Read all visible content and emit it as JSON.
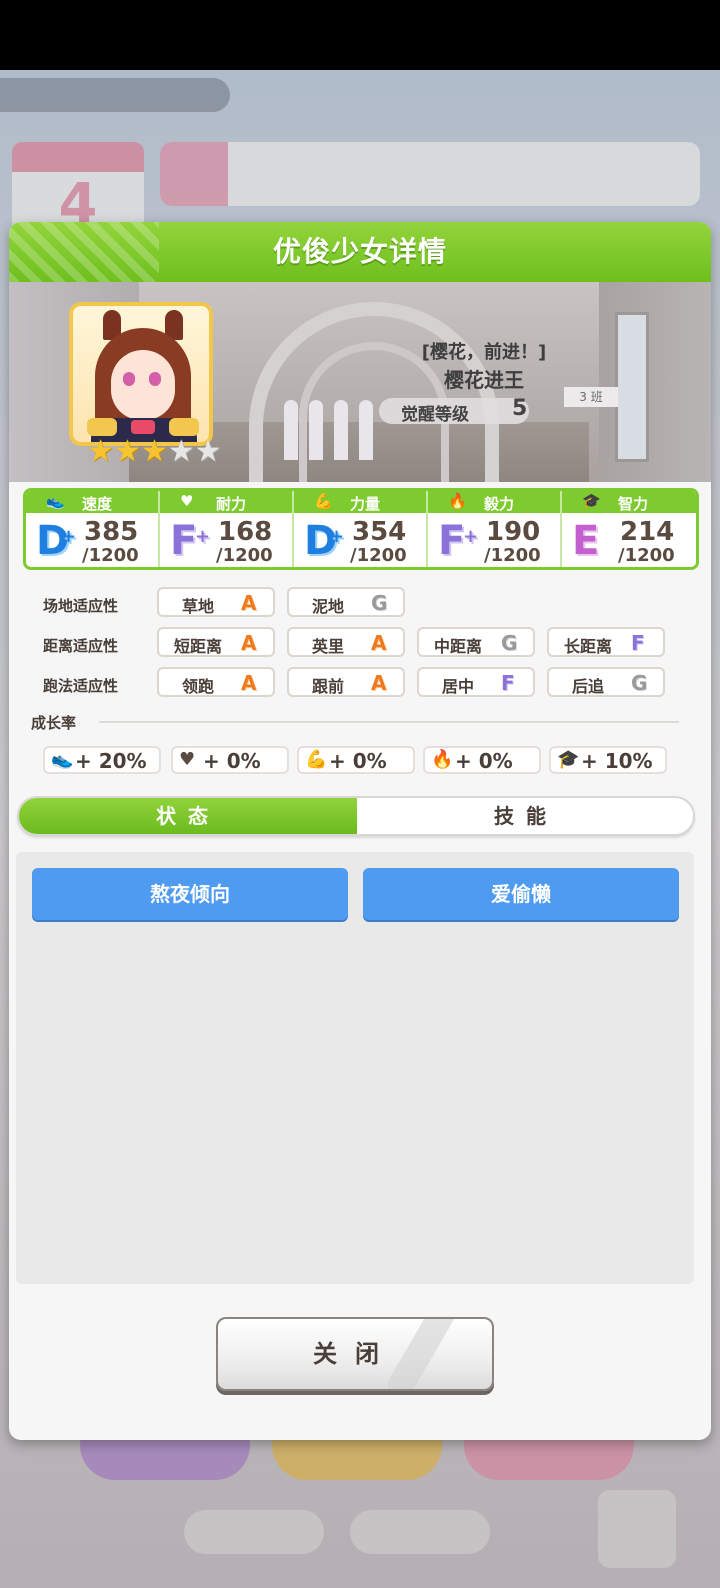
{
  "dialog": {
    "title": "优俊少女详情"
  },
  "character": {
    "epithet": "[樱花，前进！]",
    "name": "樱花进王",
    "awakening_label": "觉醒等级",
    "awakening_level": "5",
    "stars_filled": 3,
    "stars_total": 5,
    "star_glyph": "★",
    "class_sign": "3 班"
  },
  "stats": [
    {
      "label": "速度",
      "icon": "shoe-icon",
      "icon_glyph": "👟",
      "grade": "D",
      "plus": "+",
      "value": "385",
      "max": "/1200"
    },
    {
      "label": "耐力",
      "icon": "heart-icon",
      "icon_glyph": "♥",
      "grade": "F",
      "plus": "+",
      "value": "168",
      "max": "/1200"
    },
    {
      "label": "力量",
      "icon": "muscle-icon",
      "icon_glyph": "💪",
      "grade": "D",
      "plus": "+",
      "value": "354",
      "max": "/1200"
    },
    {
      "label": "毅力",
      "icon": "flame-icon",
      "icon_glyph": "🔥",
      "grade": "F",
      "plus": "+",
      "value": "190",
      "max": "/1200"
    },
    {
      "label": "智力",
      "icon": "graduation-cap-icon",
      "icon_glyph": "🎓",
      "grade": "E",
      "plus": "",
      "value": "214",
      "max": "/1200"
    }
  ],
  "aptitudes": {
    "track": {
      "label": "场地适应性",
      "items": [
        {
          "name": "草地",
          "grade": "A"
        },
        {
          "name": "泥地",
          "grade": "G"
        }
      ]
    },
    "distance": {
      "label": "距离适应性",
      "items": [
        {
          "name": "短距离",
          "grade": "A"
        },
        {
          "name": "英里",
          "grade": "A"
        },
        {
          "name": "中距离",
          "grade": "G"
        },
        {
          "name": "长距离",
          "grade": "F"
        }
      ]
    },
    "style": {
      "label": "跑法适应性",
      "items": [
        {
          "name": "领跑",
          "grade": "A"
        },
        {
          "name": "跟前",
          "grade": "A"
        },
        {
          "name": "居中",
          "grade": "F"
        },
        {
          "name": "后追",
          "grade": "G"
        }
      ]
    }
  },
  "growth": {
    "title": "成长率",
    "items": [
      {
        "icon": "shoe-icon",
        "icon_glyph": "👟",
        "value": "+ 20%"
      },
      {
        "icon": "heart-icon",
        "icon_glyph": "♥",
        "value": "+ 0%"
      },
      {
        "icon": "muscle-icon",
        "icon_glyph": "💪",
        "value": "+ 0%"
      },
      {
        "icon": "flame-icon",
        "icon_glyph": "🔥",
        "value": "+ 0%"
      },
      {
        "icon": "graduation-cap-icon",
        "icon_glyph": "🎓",
        "value": "+ 10%"
      }
    ]
  },
  "tabs": [
    {
      "label": "状态",
      "active": true
    },
    {
      "label": "技能",
      "active": false
    }
  ],
  "status_tags": [
    "熬夜倾向",
    "爱偷懒"
  ],
  "close_label": "关闭",
  "colors": {
    "header_green": "#7dcb2e",
    "tag_blue": "#4e9bf0",
    "grade_A": "#f07a20",
    "grade_D": "#1e7fe0",
    "grade_F": "#8a72d8",
    "grade_E": "#c45fd0",
    "grade_G": "#9a9a9a"
  }
}
